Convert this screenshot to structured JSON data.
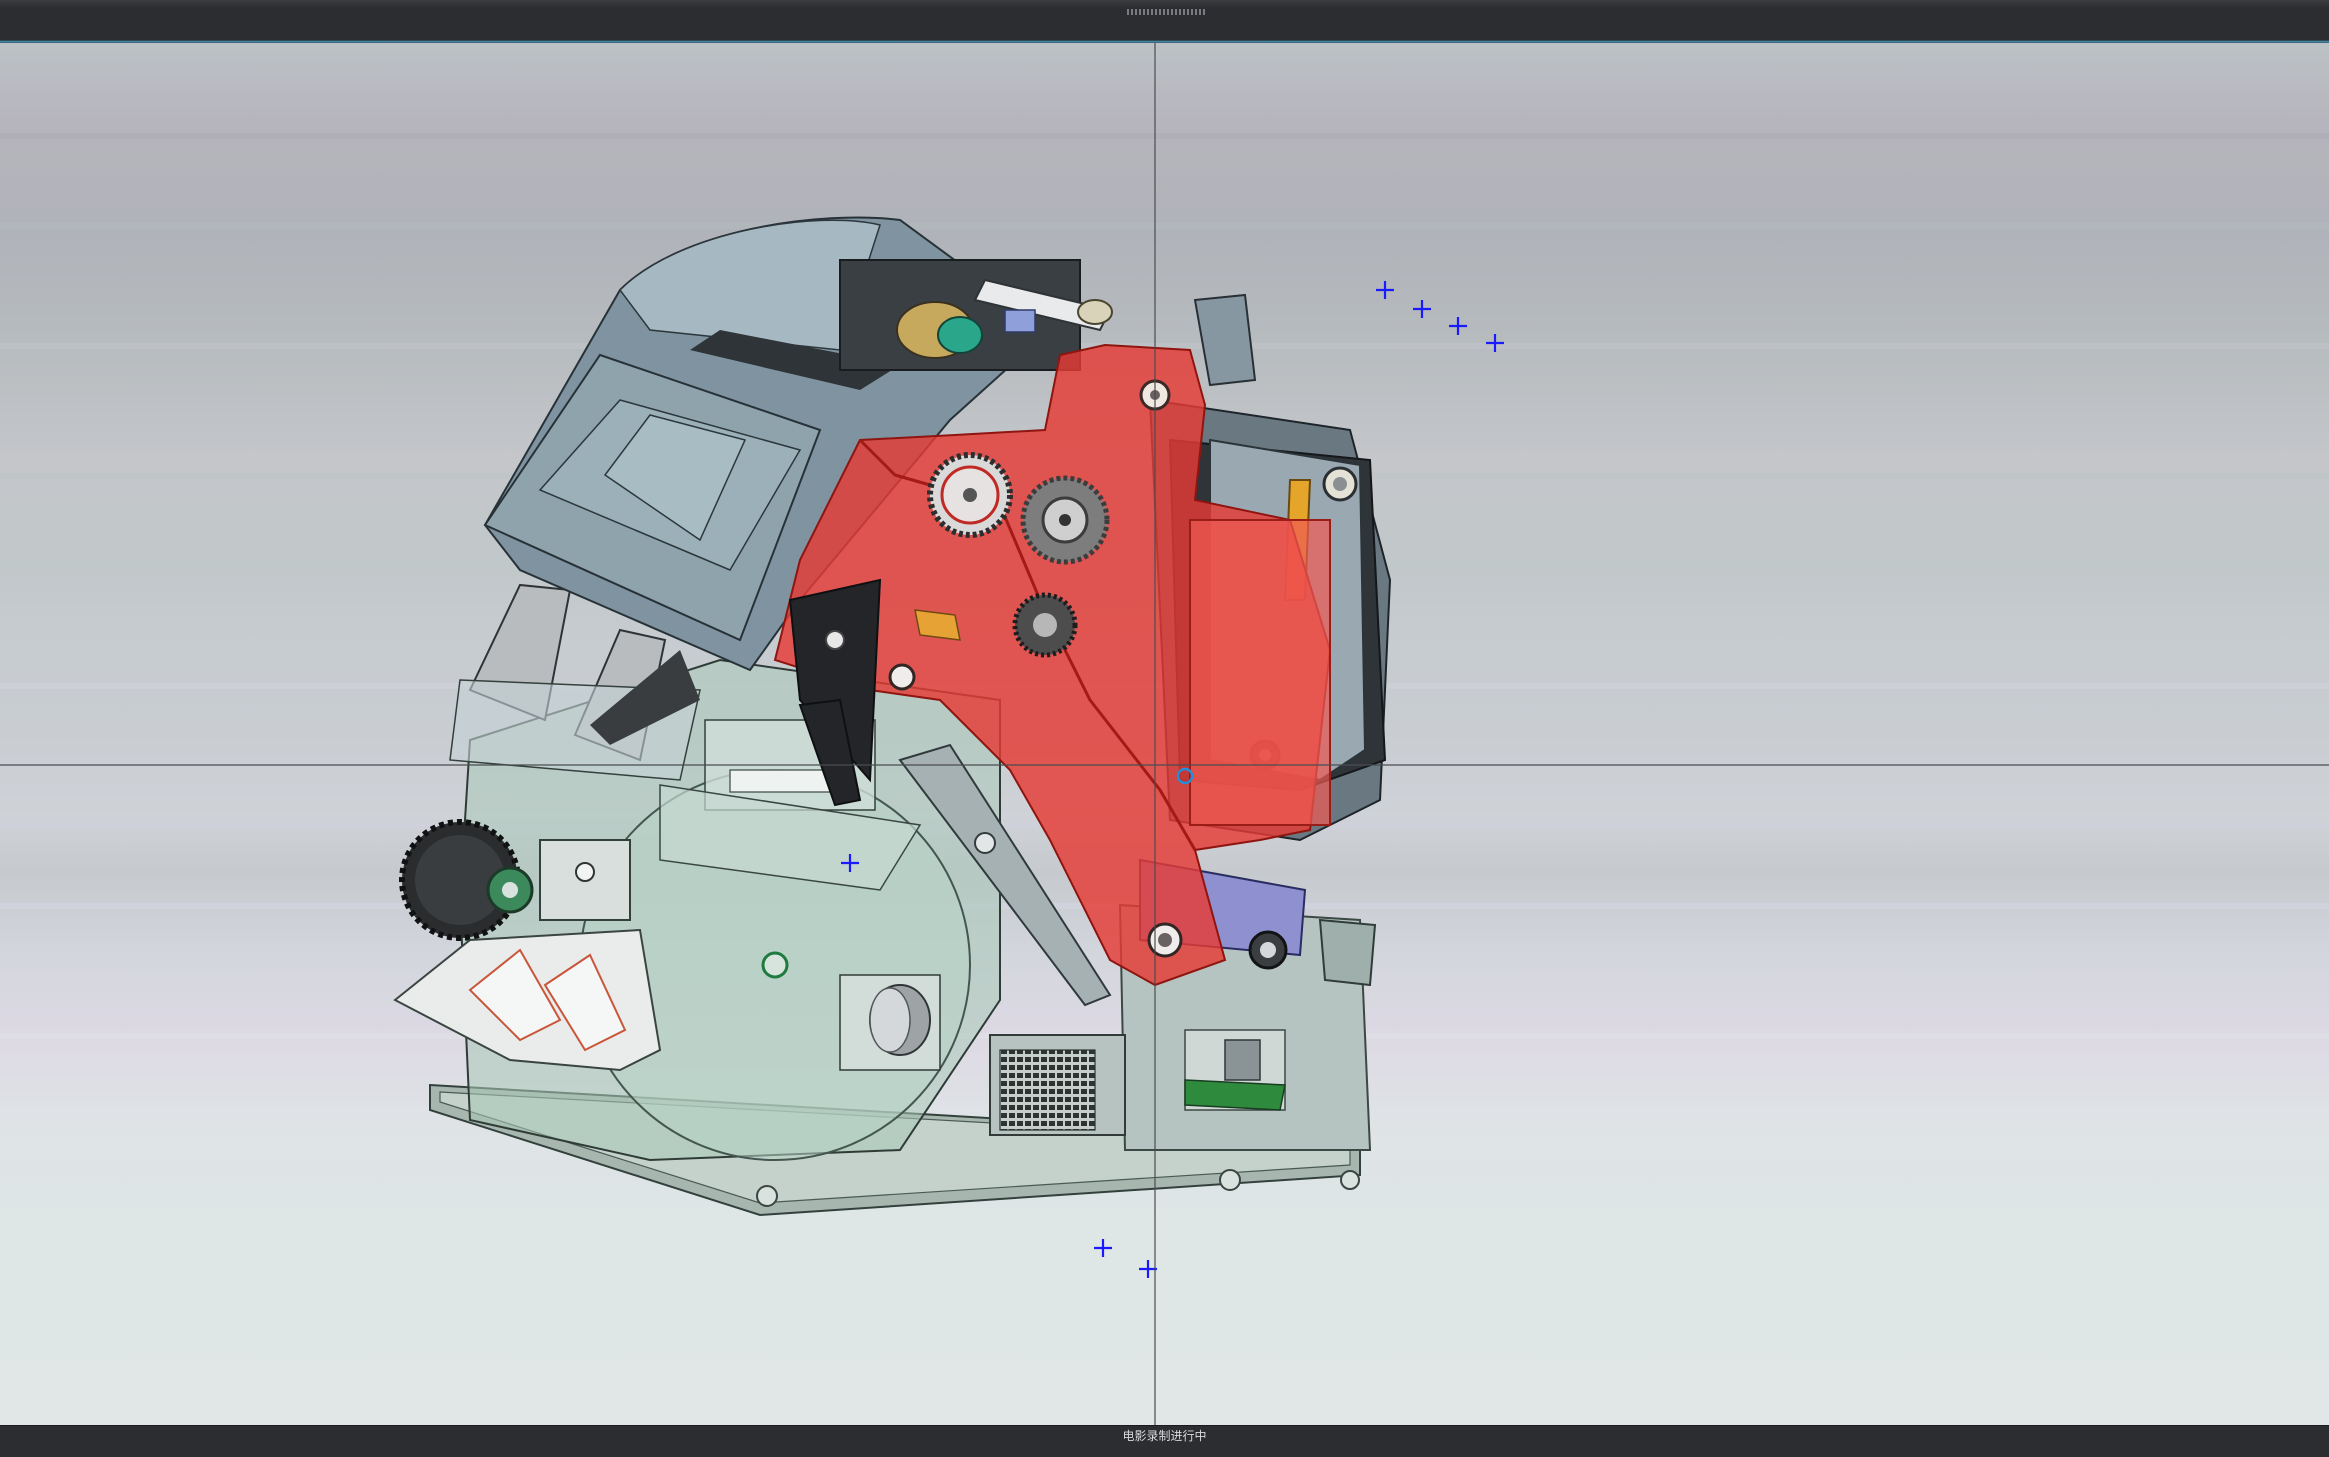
{
  "status_bar": {
    "recording_label": "电影录制进行中"
  },
  "colors": {
    "background_top": "#bcc2c6",
    "background_bottom": "#e0e7e6",
    "highlight_part": "#e53b34",
    "datum_marker": "#1a1aff",
    "crosshair": "#4a4c50",
    "frame_bar": "#2b2d31"
  },
  "viewport": {
    "model_name": "cad-assembly-model",
    "selected_part": "highlighted-red-side-frame",
    "marker_icon": "blue-plus-marker",
    "pivot_icon": "blue-circle-pivot"
  }
}
